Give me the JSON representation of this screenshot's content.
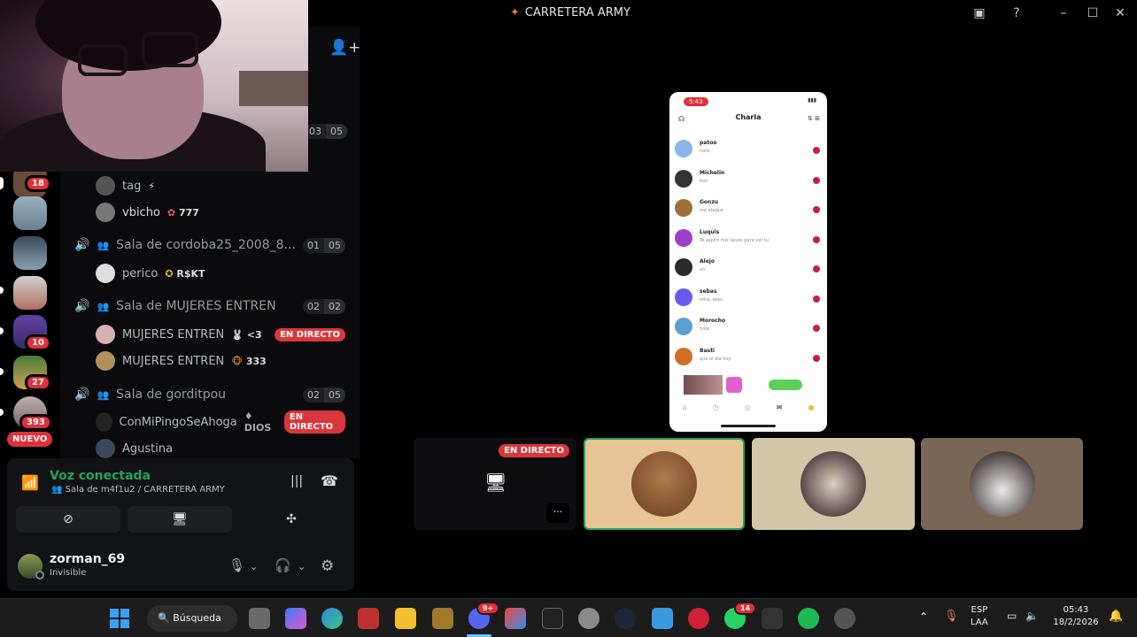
{
  "window": {
    "title": "CARRETERA ARMY"
  },
  "rail": {
    "badges": [
      "18",
      "10",
      "27",
      "393"
    ],
    "nuevo_label": "NUEVO"
  },
  "channel_list": {
    "top_counts": [
      "03",
      "05"
    ],
    "users_top": [
      {
        "name": "tag",
        "tag": ""
      },
      {
        "name": "vbicho",
        "tag": "777"
      }
    ],
    "rooms": [
      {
        "name": "Sala de cordoba25_2008_8...",
        "count_a": "01",
        "count_b": "05",
        "members": [
          {
            "name": "perico",
            "tag": "R$KT"
          }
        ]
      },
      {
        "name": "Sala de MUJERES ENTREN",
        "count_a": "02",
        "count_b": "02",
        "members": [
          {
            "name": "MUJERES ENTREN",
            "tag": "<3",
            "live": "EN DIRECTO"
          },
          {
            "name": "MUJERES ENTREN",
            "tag": "333"
          }
        ]
      },
      {
        "name": "Sala de gorditpou",
        "count_a": "02",
        "count_b": "05",
        "members": [
          {
            "name": "ConMiPingoSeAhoga",
            "tag": "DIOS",
            "live": "EN DIRECTO"
          },
          {
            "name": "Agustina",
            "tag": ""
          }
        ]
      }
    ]
  },
  "voice": {
    "status": "Voz conectada",
    "location": "Sala de m4f1u2 / CARRETERA ARMY"
  },
  "account": {
    "username": "zorman_69",
    "status": "Invisible"
  },
  "stage": {
    "live_label": "EN DIRECTO",
    "more_label": "···",
    "phone": {
      "time": "5:43",
      "title": "Charla",
      "chats": [
        {
          "name": "patoo",
          "msg": "holis",
          "color": "#8ab6e8"
        },
        {
          "name": "Michelin",
          "msg": "holi",
          "color": "#333333"
        },
        {
          "name": "Gonzu",
          "msg": "me ataque",
          "color": "#a0703a"
        },
        {
          "name": "Luquis",
          "msg": "Te aspiro mis llaves para ver tu",
          "color": "#9b40c8"
        },
        {
          "name": "Alejo",
          "msg": "ah",
          "color": "#2a2a2a"
        },
        {
          "name": "sebas",
          "msg": "mira, sexo",
          "color": "#6a5af0"
        },
        {
          "name": "Morocho",
          "msg": "hola",
          "color": "#5aa0d0"
        },
        {
          "name": "Basti",
          "msg": "que el dia hoy",
          "color": "#d07020"
        }
      ]
    }
  },
  "taskbar": {
    "search_label": "Búsqueda",
    "discord_badge": "9+",
    "whatsapp_badge": "14",
    "lang_top": "ESP",
    "lang_bottom": "LAA",
    "time": "05:43",
    "date": "18/2/2026"
  }
}
